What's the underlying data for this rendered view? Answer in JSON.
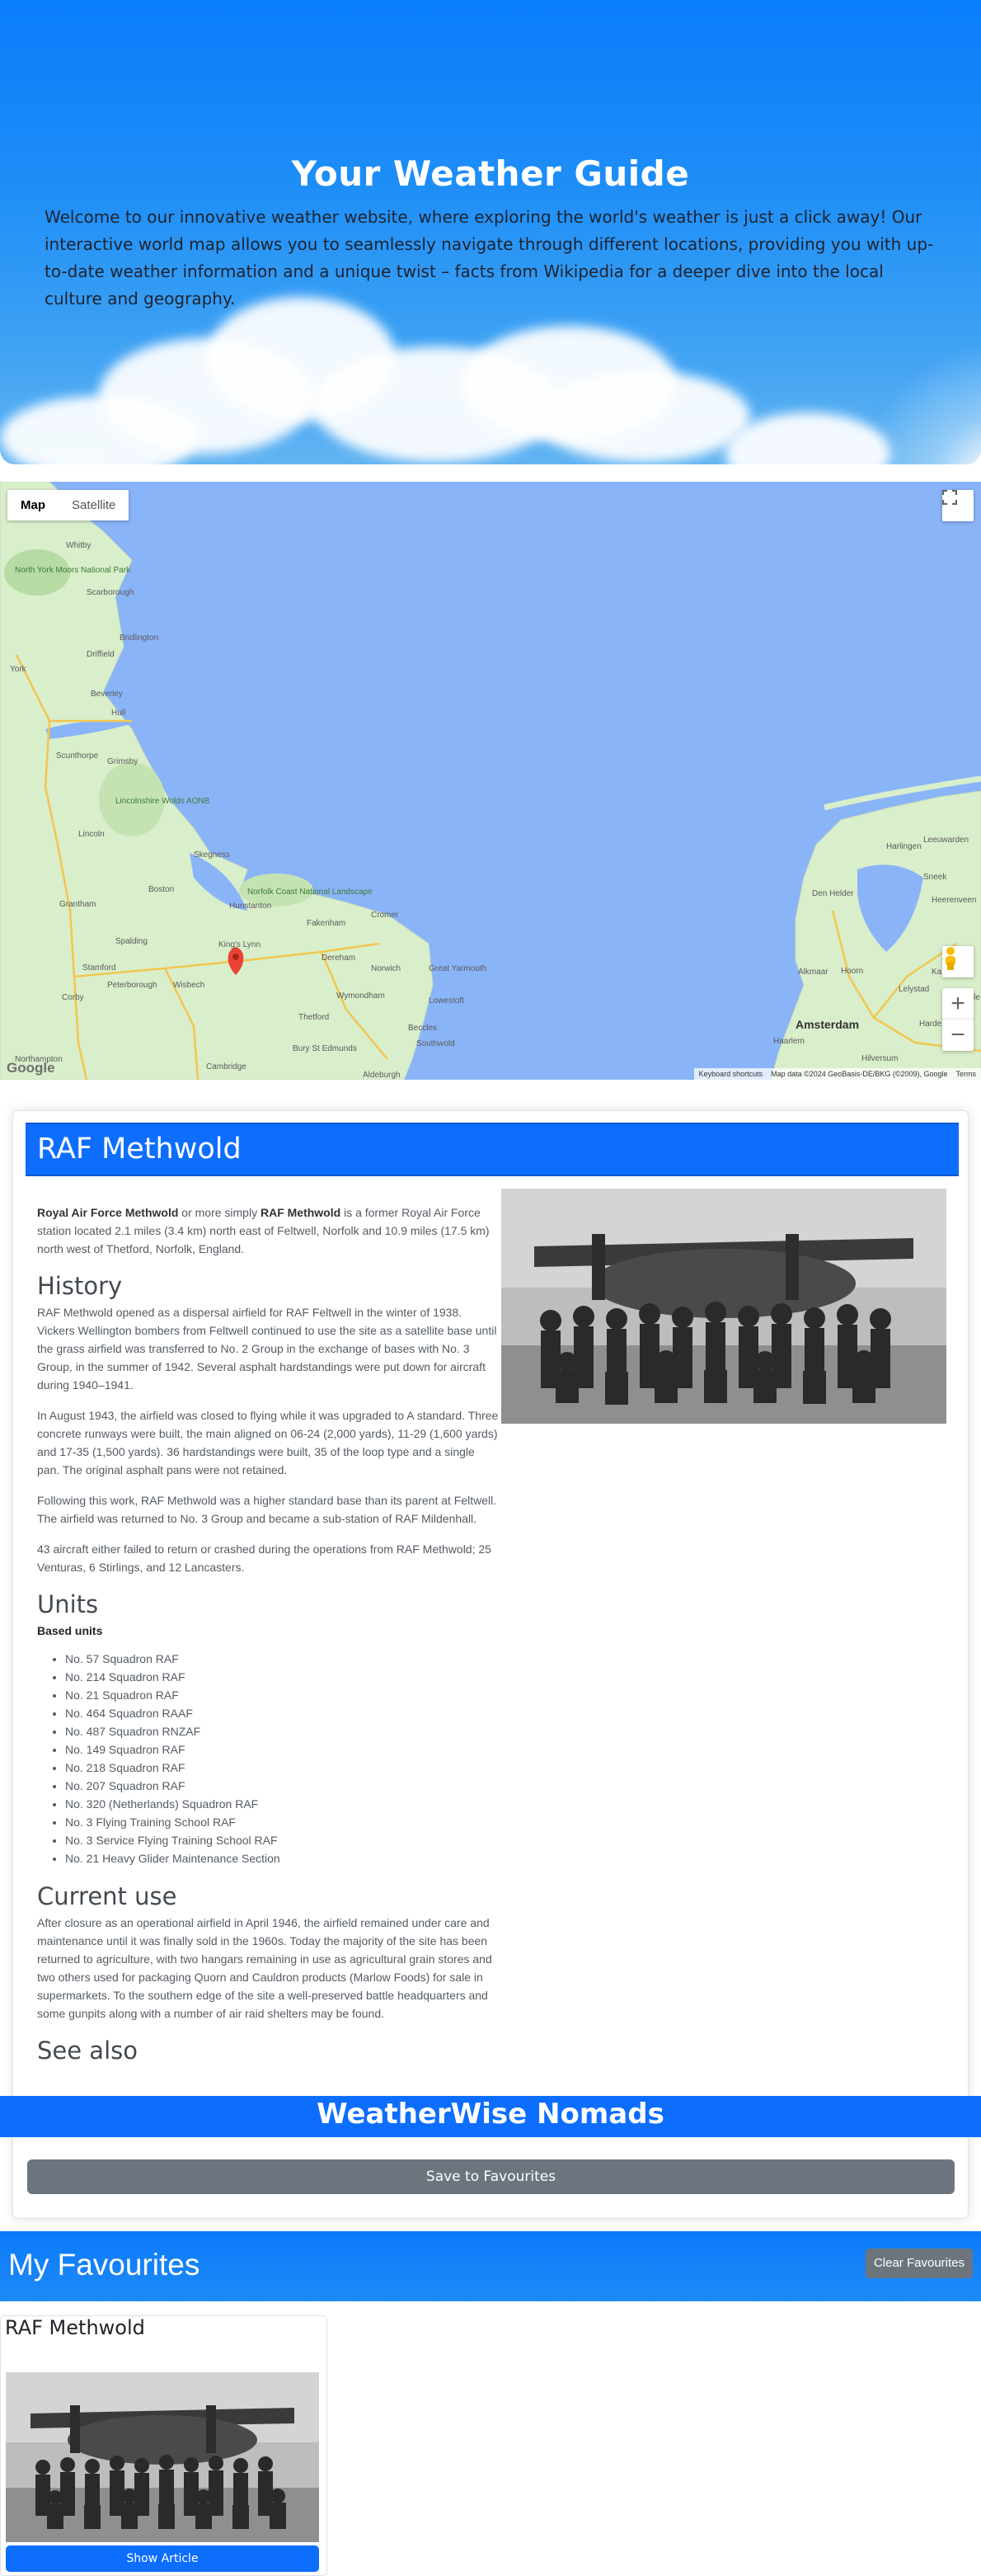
{
  "hero": {
    "title": "Your Weather Guide",
    "text": "Welcome to our innovative weather website, where exploring the world's weather is just a click away! Our interactive world map allows you to seamlessly navigate through different locations, providing you with up-to-date weather information and a unique twist – facts from Wikipedia for a deeper dive into the local culture and geography."
  },
  "map": {
    "map_label": "Map",
    "satellite_label": "Satellite",
    "places": [
      "Whitby",
      "North York Moors National Park",
      "Scarborough",
      "Bridlington",
      "Driffield",
      "York",
      "Beverley",
      "Hull",
      "Scunthorpe",
      "Grimsby",
      "Lincolnshire Wolds AONB",
      "Lincoln",
      "Skegness",
      "Boston",
      "Grantham",
      "Hunstanton",
      "Norfolk Coast National Landscape",
      "Cromer",
      "Fakenham",
      "King's Lynn",
      "Spalding",
      "Dereham",
      "Norwich",
      "Great Yarmouth",
      "Stamford",
      "Peterborough",
      "Wisbech",
      "Wymondham",
      "Lowestoft",
      "Corby",
      "Thetford",
      "Beccles",
      "Bury St Edmunds",
      "Southwold",
      "Northampton",
      "Cambridge",
      "Aldeburgh",
      "Harlingen",
      "Leeuwarden",
      "Sneek",
      "Den Helder",
      "Heerenveen",
      "Lelystad",
      "Alkmaar",
      "Hoorn",
      "Kampen",
      "Amsterdam",
      "Haarlem",
      "Zwolle",
      "Harderwijk",
      "Hilversum"
    ],
    "attribution": [
      "Keyboard shortcuts",
      "Map data ©2024 GeoBasis-DE/BKG (©2009), Google",
      "Terms"
    ],
    "logo": "Google"
  },
  "article": {
    "title": "RAF Methwold",
    "intro_b1": "Royal Air Force Methwold",
    "intro_t1": " or more simply ",
    "intro_b2": "RAF Methwold",
    "intro_t2": " is a former Royal Air Force station located 2.1 miles (3.4 km) north east of Feltwell, Norfolk and 10.9 miles (17.5 km) north west of Thetford, Norfolk, England.",
    "history_heading": "History",
    "history": [
      "RAF Methwold opened as a dispersal airfield for RAF Feltwell in the winter of 1938. Vickers Wellington bombers from Feltwell continued to use the site as a satellite base until the grass airfield was transferred to No. 2 Group in the exchange of bases with No. 3 Group, in the summer of 1942. Several asphalt hardstandings were put down for aircraft during 1940–1941.",
      "In August 1943, the airfield was closed to flying while it was upgraded to A standard. Three concrete runways were built, the main aligned on 06-24 (2,000 yards), 11-29 (1,600 yards) and 17-35 (1,500 yards). 36 hardstandings were built, 35 of the loop type and a single pan. The original asphalt pans were not retained.",
      "Following this work, RAF Methwold was a higher standard base than its parent at Feltwell. The airfield was returned to No. 3 Group and became a sub-station of RAF Mildenhall.",
      "43 aircraft either failed to return or crashed during the operations from RAF Methwold; 25 Venturas, 6 Stirlings, and 12 Lancasters."
    ],
    "units_heading": "Units",
    "units_subheading": "Based units",
    "units": [
      "No. 57 Squadron RAF",
      "No. 214 Squadron RAF",
      "No. 21 Squadron RAF",
      "No. 464 Squadron RAAF",
      "No. 487 Squadron RNZAF",
      "No. 149 Squadron RAF",
      "No. 218 Squadron RAF",
      "No. 207 Squadron RAF",
      "No. 320 (Netherlands) Squadron RAF",
      "No. 3 Flying Training School RAF",
      "No. 3 Service Flying Training School RAF",
      "No. 21 Heavy Glider Maintenance Section"
    ],
    "current_heading": "Current use",
    "current": "After closure as an operational airfield in April 1946, the airfield remained under care and maintenance until it was finally sold in the 1960s. Today the majority of the site has been returned to agriculture, with two hangars remaining in use as agricultural grain stores and two others used for packaging Quorn and Cauldron products (Marlow Foods) for sale in supermarkets. To the southern edge of the site a well-preserved battle headquarters and some gunpits along with a number of air raid shelters may be found.",
    "see_also_heading": "See also",
    "brand": "WeatherWise Nomads",
    "save_label": "Save to Favourites"
  },
  "favourites": {
    "title": "My Favourites",
    "clear_label": "Clear Favourites",
    "items": [
      {
        "title": "RAF Methwold",
        "button": "Show Article"
      }
    ]
  },
  "colors": {
    "primary": "#0d6efd",
    "secondary": "#6c757d",
    "water": "#8ab4f8",
    "land": "#d7eec9"
  }
}
